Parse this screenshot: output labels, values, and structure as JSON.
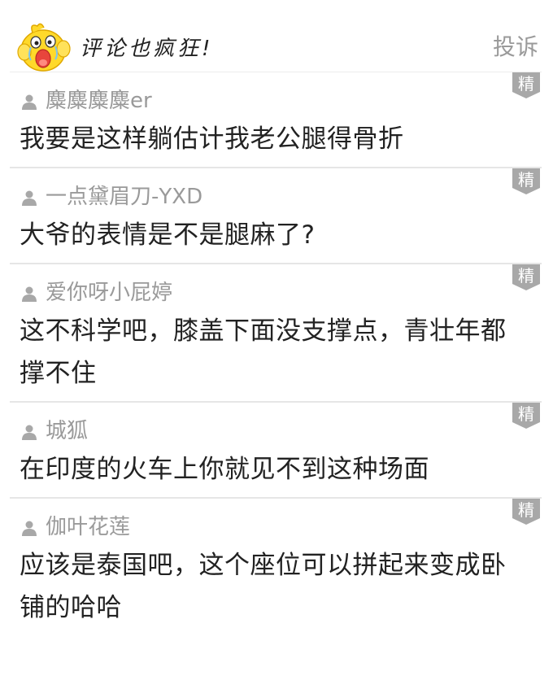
{
  "header": {
    "title": "评论也疯狂!",
    "report_label": "投诉"
  },
  "badge_label": "精",
  "colors": {
    "username": "#9a9a9a",
    "text": "#222222",
    "badge": "#a8a8a8",
    "divider": "#e6e6e6"
  },
  "comments": [
    {
      "user": "麋麋麋麋er",
      "text": "我要是这样躺估计我老公腿得骨折"
    },
    {
      "user": "一点黛眉刀-YXD",
      "text": "大爷的表情是不是腿麻了?"
    },
    {
      "user": "爱你呀小屁婷",
      "text": "这不科学吧，膝盖下面没支撑点，青壮年都撑不住"
    },
    {
      "user": "城狐",
      "text": "在印度的火车上你就见不到这种场面"
    },
    {
      "user": "伽叶花莲",
      "text": "应该是泰国吧，这个座位可以拼起来变成卧铺的哈哈"
    }
  ]
}
